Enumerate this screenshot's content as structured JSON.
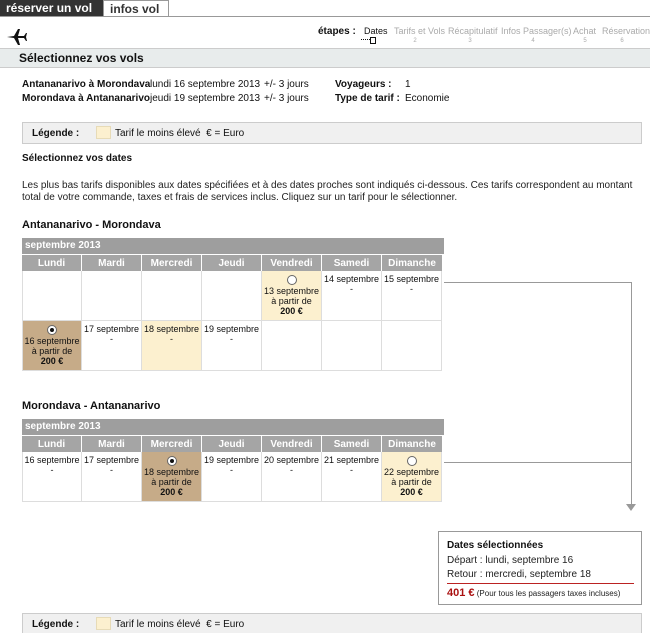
{
  "tabs": {
    "reserve": "réserver un vol",
    "info": "infos vol"
  },
  "steps": {
    "label": "étapes :",
    "items": [
      {
        "label": "Dates",
        "num": "1"
      },
      {
        "label": "Tarifs et Vols",
        "num": "2"
      },
      {
        "label": "Récapitulatif",
        "num": "3"
      },
      {
        "label": "Infos Passager(s)",
        "num": "4"
      },
      {
        "label": "Achat",
        "num": "5"
      },
      {
        "label": "Réservation",
        "num": "6"
      }
    ]
  },
  "section_title": "Sélectionnez vos vols",
  "summary": {
    "outbound_route": "Antananarivo à Morondava",
    "outbound_date": "lundi 16 septembre 2013",
    "outbound_flex": "+/- 3 jours",
    "return_route": "Morondava à Antananarivo",
    "return_date": "jeudi 19 septembre 2013",
    "return_flex": "+/- 3 jours",
    "travellers_label": "Voyageurs :",
    "travellers_value": "1",
    "fare_label": "Type de tarif :",
    "fare_value": "Economie"
  },
  "legend": {
    "label": "Légende :",
    "cheapest": "Tarif le moins élevé",
    "currency": "€ = Euro"
  },
  "select_dates_heading": "Sélectionnez vos dates",
  "intro": "Les plus bas tarifs disponibles aux dates spécifiées et à des dates proches sont indiqués ci-dessous. Ces tarifs correspondent au montant total de votre commande, taxes et frais de services inclus. Cliquez sur un tarif pour le sélectionner.",
  "weekdays": [
    "Lundi",
    "Mardi",
    "Mercredi",
    "Jeudi",
    "Vendredi",
    "Samedi",
    "Dimanche"
  ],
  "outbound": {
    "title": "Antananarivo - Morondava",
    "month": "septembre 2013",
    "fri13": {
      "date": "13 septembre",
      "from": "à partir de",
      "price": "200 €"
    },
    "sat14": {
      "date": "14 septembre",
      "dash": "-"
    },
    "sun15": {
      "date": "15 septembre",
      "dash": "-"
    },
    "mon16": {
      "date": "16 septembre",
      "from": "à partir de",
      "price": "200 €"
    },
    "tue17": {
      "date": "17 septembre",
      "dash": "-"
    },
    "wed18": {
      "date": "18 septembre",
      "dash": "-"
    },
    "thu19": {
      "date": "19 septembre",
      "dash": "-"
    }
  },
  "inbound": {
    "title": "Morondava - Antananarivo",
    "month": "septembre 2013",
    "mon16": {
      "date": "16 septembre",
      "dash": "-"
    },
    "tue17": {
      "date": "17 septembre",
      "dash": "-"
    },
    "wed18": {
      "date": "18 septembre",
      "from": "à partir de",
      "price": "200 €"
    },
    "thu19": {
      "date": "19 septembre",
      "dash": "-"
    },
    "fri20": {
      "date": "20 septembre",
      "dash": "-"
    },
    "sat21": {
      "date": "21 septembre",
      "dash": "-"
    },
    "sun22": {
      "date": "22 septembre",
      "from": "à partir de",
      "price": "200 €"
    }
  },
  "selected_dates": {
    "title": "Dates sélectionnées",
    "depart": "Départ : lundi, septembre 16",
    "retour": "Retour : mercredi, septembre 18",
    "total": "401 €",
    "total_note": "(Pour tous les passagers taxes incluses)"
  },
  "colors": {
    "cheapest": "#fcf0cf",
    "selected": "#c6ab88",
    "header_gray": "#a5a5a5",
    "price_red": "#a11111"
  }
}
